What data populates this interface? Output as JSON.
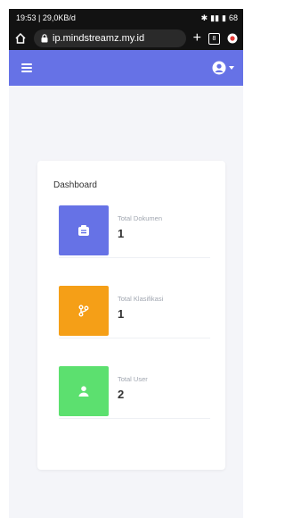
{
  "status_bar": {
    "left_text": "19:53 | 29,0KB/d",
    "right_text": "68"
  },
  "browser": {
    "url": "ip.mindstreamz.my.id",
    "tab_count": "8"
  },
  "app_header": {
    "accent_color": "#6672e6"
  },
  "dashboard": {
    "title": "Dashboard",
    "stats": [
      {
        "label": "Total Dokumen",
        "value": "1",
        "color": "#6672e6",
        "icon": "document-icon"
      },
      {
        "label": "Total Klasifikasi",
        "value": "1",
        "color": "#f59f17",
        "icon": "branch-icon"
      },
      {
        "label": "Total User",
        "value": "2",
        "color": "#5ce06f",
        "icon": "user-icon"
      }
    ]
  }
}
